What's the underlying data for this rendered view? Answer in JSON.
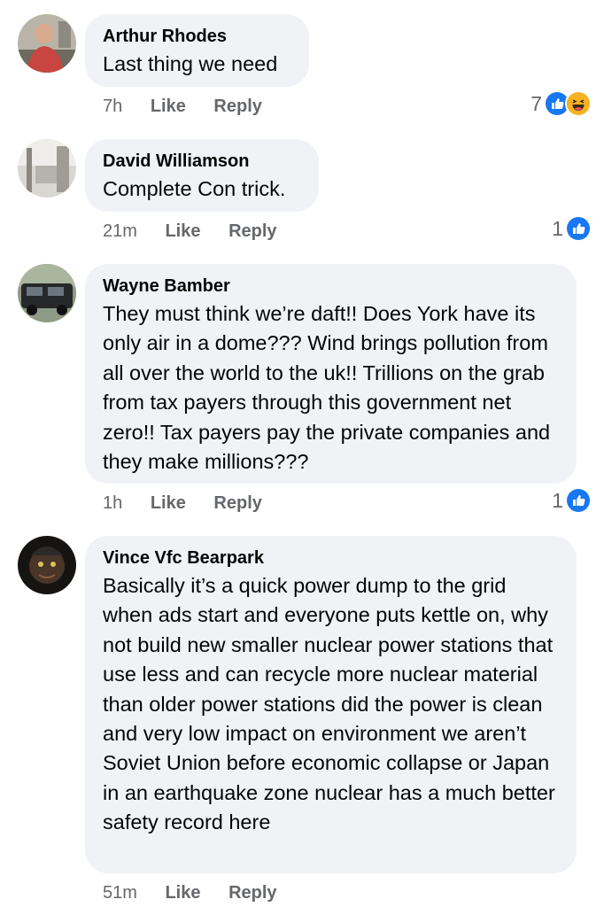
{
  "colors": {
    "bubble": "#f0f2f5",
    "meta_text": "#65676b",
    "like_blue": "#1877f2",
    "haha_yellow": "#f7b125"
  },
  "action_labels": {
    "like": "Like",
    "reply": "Reply"
  },
  "comments": [
    {
      "author": "Arthur Rhodes",
      "text": "Last thing we need",
      "time": "7h",
      "reaction_count": "7",
      "reactions": [
        "like-icon",
        "haha-icon"
      ]
    },
    {
      "author": "David Williamson",
      "text": "Complete Con trick.",
      "time": "21m",
      "reaction_count": "1",
      "reactions": [
        "like-icon"
      ]
    },
    {
      "author": "Wayne Bamber",
      "text": "They must think we’re daft!! Does York have its only air in a dome??? Wind brings pollution from all over the world to the uk!! Trillions on the grab from tax payers through this government net zero!! Tax payers pay the private companies and they make millions???",
      "time": "1h",
      "reaction_count": "1",
      "reactions": [
        "like-icon"
      ]
    },
    {
      "author": "Vince Vfc Bearpark",
      "text": "Basically it’s a quick power dump to the grid when ads start and everyone puts kettle on, why not build new smaller nuclear power stations that use less and can recycle more nuclear material than older power stations did the power is clean and very low impact on environment we aren’t Soviet Union before economic collapse or Japan in an earthquake zone nuclear has a much better safety record here",
      "time": "51m",
      "reaction_count": "",
      "reactions": []
    }
  ]
}
